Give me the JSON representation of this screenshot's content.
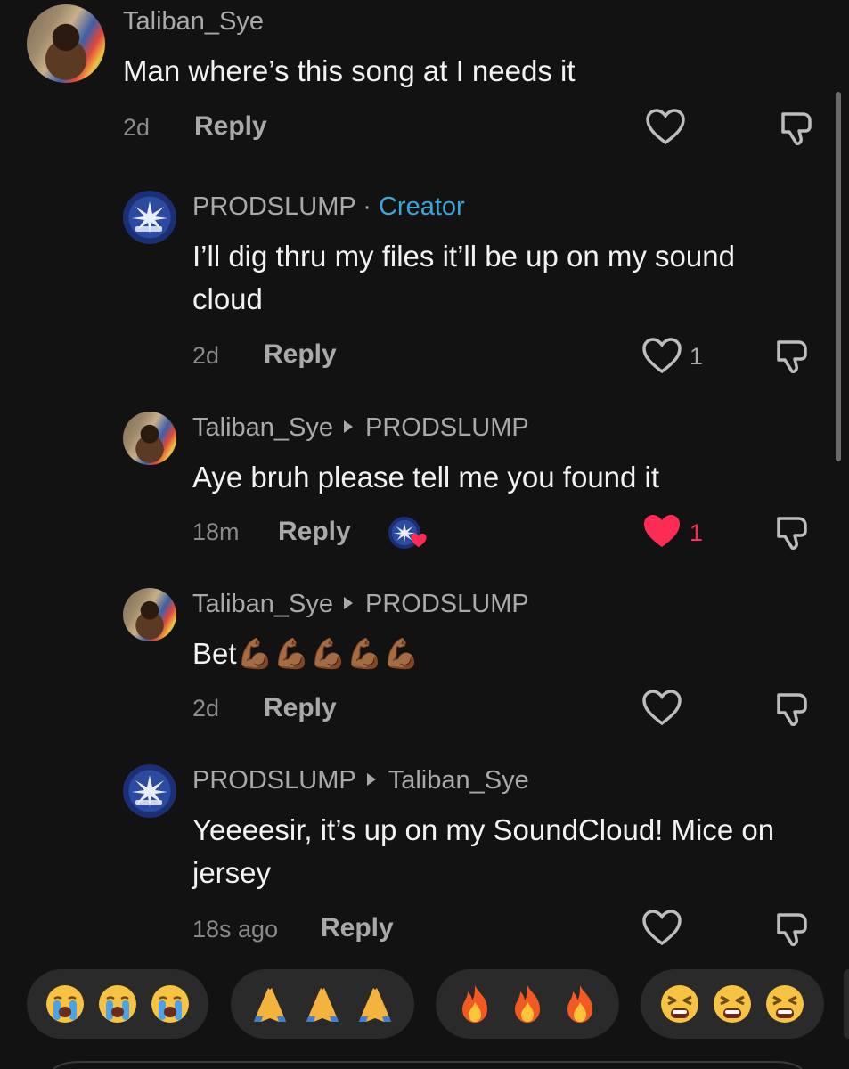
{
  "comments": [
    {
      "username": "Taliban_Sye",
      "text": "Man where’s this song at I needs it",
      "time": "2d",
      "reply": "Reply",
      "likes": ""
    },
    {
      "username": "PRODSLUMP",
      "badge": "Creator",
      "text": "I’ll dig thru my files it’ll be up on my sound cloud",
      "time": "2d",
      "reply": "Reply",
      "likes": "1"
    },
    {
      "username": "Taliban_Sye",
      "reply_to": "PRODSLUMP",
      "text": "Aye bruh please tell me you found it",
      "time": "18m",
      "reply": "Reply",
      "likes": "1",
      "liked": true
    },
    {
      "username": "Taliban_Sye",
      "reply_to": "PRODSLUMP",
      "text": "Bet💪🏾💪🏾💪🏾💪🏾💪🏾",
      "time": "2d",
      "reply": "Reply",
      "likes": ""
    },
    {
      "username": "PRODSLUMP",
      "reply_to": "Taliban_Sye",
      "text": "Yeeeesir, it’s up on my SoundCloud! Mice on jersey",
      "time": "18s ago",
      "reply": "Reply",
      "likes": ""
    }
  ],
  "creator_separator": " · ",
  "colors": {
    "creator": "#3aa7d8",
    "liked_heart": "#fe2c55",
    "background": "#121212"
  },
  "emoji_bar": [
    {
      "name": "crying-face",
      "emoji": [
        "😭",
        "😭",
        "😭"
      ]
    },
    {
      "name": "folded-hands",
      "emoji": [
        "🙏",
        "🙏",
        "🙏"
      ]
    },
    {
      "name": "fire",
      "emoji": [
        "🔥",
        "🔥",
        "🔥"
      ]
    },
    {
      "name": "tired-face",
      "emoji": [
        "😫",
        "😫",
        "😫"
      ]
    }
  ]
}
